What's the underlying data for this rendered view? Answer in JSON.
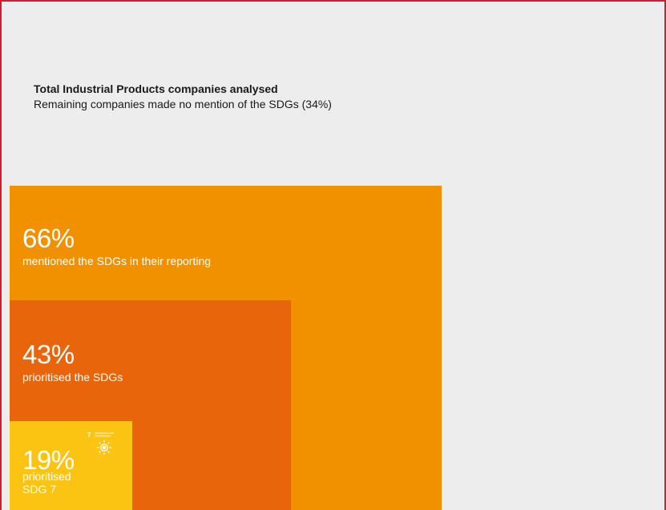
{
  "header": {
    "title": "Total Industrial Products companies analysed",
    "subtitle": "Remaining companies made no mention of the SDGs (34%)"
  },
  "chart_data": {
    "type": "bar",
    "title": "Total Industrial Products companies analysed",
    "subtitle": "Remaining companies made no mention of the SDGs (34%)",
    "categories": [
      "mentioned the SDGs in their reporting",
      "prioritised the SDGs",
      "prioritised SDG 7"
    ],
    "values": [
      66,
      43,
      19
    ],
    "labels": [
      "66%",
      "43%",
      "19%"
    ],
    "remaining": 34,
    "colors": {
      "total": "#ededed",
      "mentioned": "#f29100",
      "prioritised": "#e8650c",
      "sdg7": "#fbc412",
      "frame": "#c8202f"
    }
  },
  "boxes": [
    {
      "pct": "66%",
      "desc": "mentioned the SDGs in their reporting",
      "color": "#f29100"
    },
    {
      "pct": "43%",
      "desc": "prioritised the SDGs",
      "color": "#e8650c"
    },
    {
      "pct": "19%",
      "desc": "prioritised SDG 7",
      "color": "#fbc412"
    }
  ],
  "sdg_icon": {
    "name": "sun-icon",
    "number": "7",
    "label": "AFFORDABLE AND CLEAN ENERGY"
  }
}
